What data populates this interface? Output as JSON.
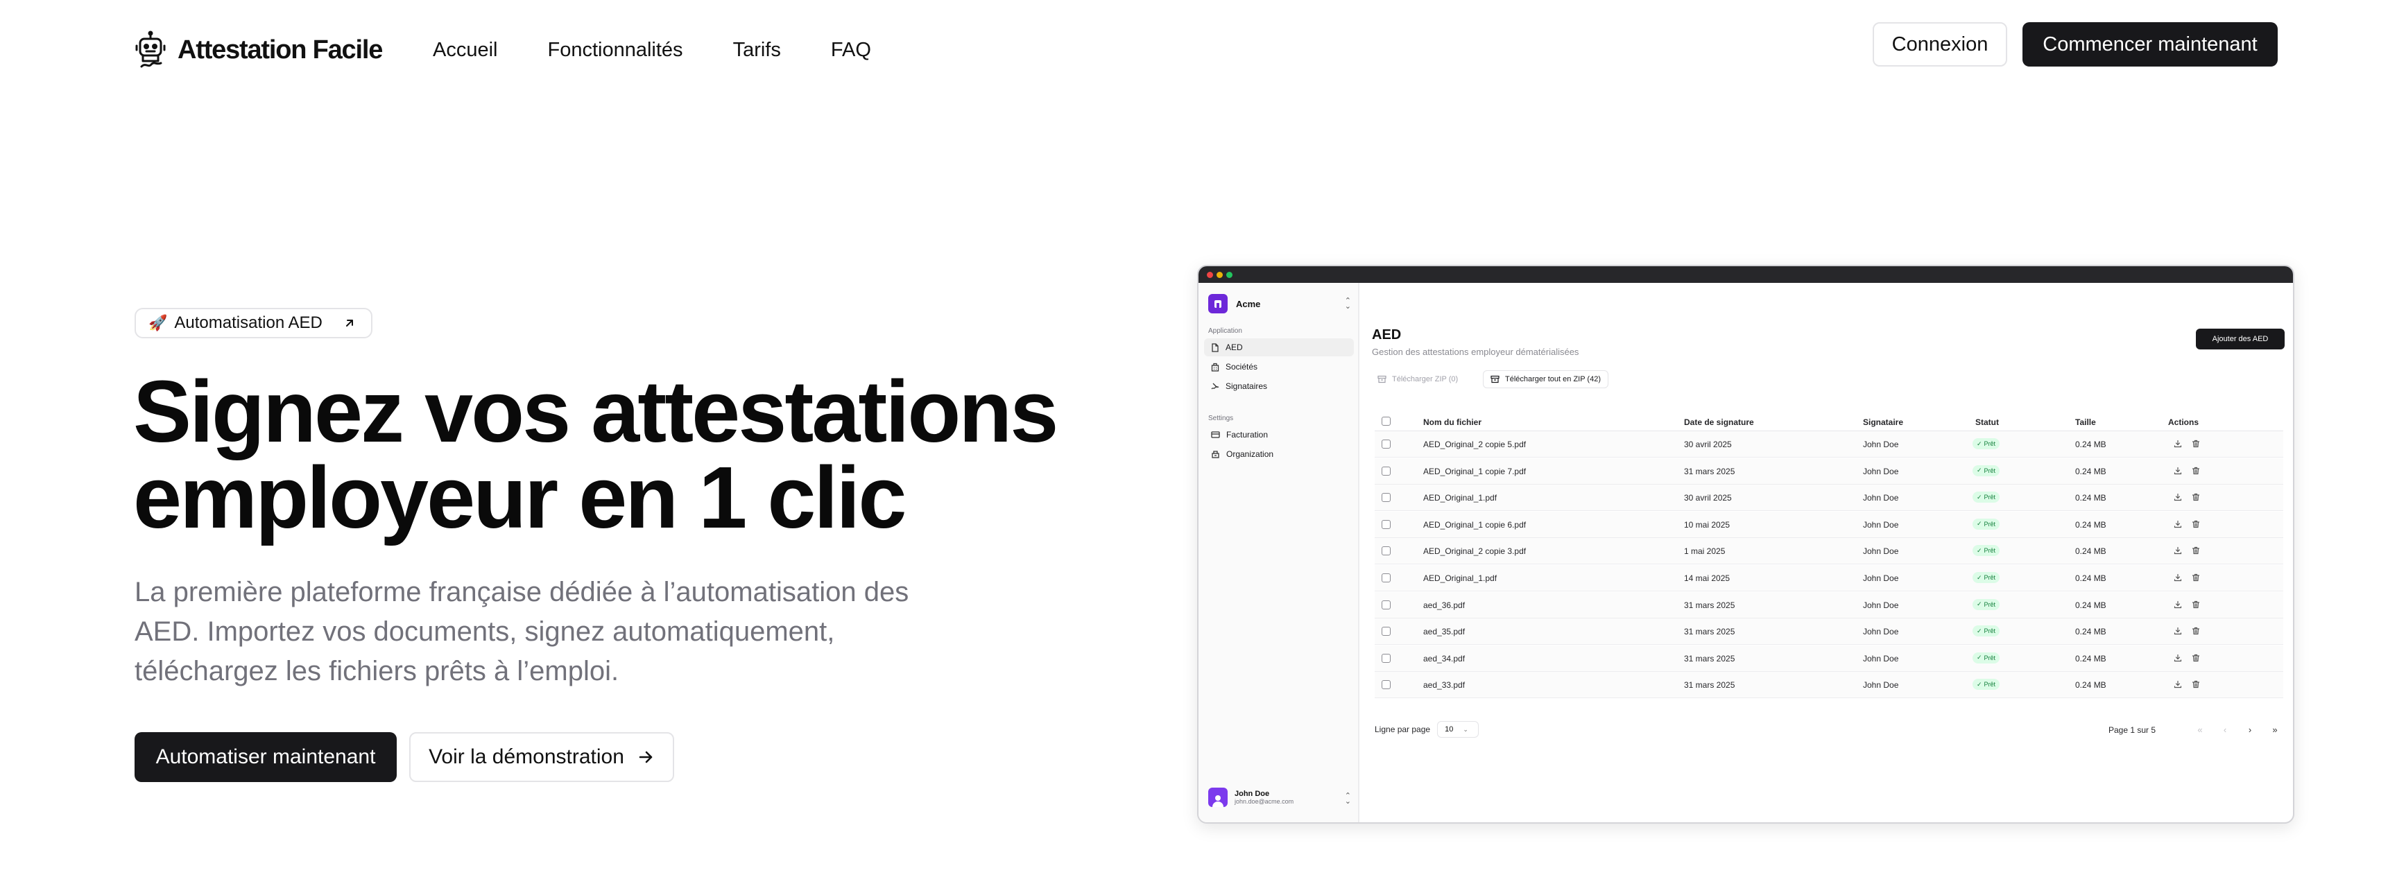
{
  "brand": {
    "name": "Attestation Facile"
  },
  "nav": {
    "links": [
      "Accueil",
      "Fonctionnalités",
      "Tarifs",
      "FAQ"
    ],
    "login": "Connexion",
    "start": "Commencer maintenant"
  },
  "hero": {
    "badge": "Automatisation AED",
    "badge_emoji": "🚀",
    "title_line1": "Signez vos attestations",
    "title_line2": "employeur en 1 clic",
    "sub_line1": "La première plateforme française dédiée à l’automatisation des",
    "sub_line2": "AED. Importez vos documents, signez automatiquement,",
    "sub_line3": "téléchargez les fichiers prêts à l’emploi.",
    "cta_primary": "Automatiser maintenant",
    "cta_secondary": "Voir la démonstration"
  },
  "app": {
    "org": "Acme",
    "sidebar": {
      "group1": "Application",
      "items1": [
        "AED",
        "Sociétés",
        "Signataires"
      ],
      "group2": "Settings",
      "items2": [
        "Facturation",
        "Organization"
      ]
    },
    "user": {
      "name": "John Doe",
      "email": "john.doe@acme.com"
    },
    "page": {
      "title": "AED",
      "subtitle": "Gestion des attestations employeur dématérialisées",
      "add_button": "Ajouter des AED",
      "zip_selected": "Télécharger ZIP (0)",
      "zip_all": "Télécharger tout en ZIP (42)"
    },
    "table": {
      "headers": [
        "Nom du fichier",
        "Date de signature",
        "Signataire",
        "Statut",
        "Taille",
        "Actions"
      ],
      "rows": [
        {
          "file": "AED_Original_2 copie 5.pdf",
          "date": "30 avril 2025",
          "signer": "John Doe",
          "status": "Prêt",
          "size": "0.24 MB"
        },
        {
          "file": "AED_Original_1 copie 7.pdf",
          "date": "31 mars 2025",
          "signer": "John Doe",
          "status": "Prêt",
          "size": "0.24 MB"
        },
        {
          "file": "AED_Original_1.pdf",
          "date": "30 avril 2025",
          "signer": "John Doe",
          "status": "Prêt",
          "size": "0.24 MB"
        },
        {
          "file": "AED_Original_1 copie 6.pdf",
          "date": "10 mai 2025",
          "signer": "John Doe",
          "status": "Prêt",
          "size": "0.24 MB"
        },
        {
          "file": "AED_Original_2 copie 3.pdf",
          "date": "1 mai 2025",
          "signer": "John Doe",
          "status": "Prêt",
          "size": "0.24 MB"
        },
        {
          "file": "AED_Original_1.pdf",
          "date": "14 mai 2025",
          "signer": "John Doe",
          "status": "Prêt",
          "size": "0.24 MB"
        },
        {
          "file": "aed_36.pdf",
          "date": "31 mars 2025",
          "signer": "John Doe",
          "status": "Prêt",
          "size": "0.24 MB"
        },
        {
          "file": "aed_35.pdf",
          "date": "31 mars 2025",
          "signer": "John Doe",
          "status": "Prêt",
          "size": "0.24 MB"
        },
        {
          "file": "aed_34.pdf",
          "date": "31 mars 2025",
          "signer": "John Doe",
          "status": "Prêt",
          "size": "0.24 MB"
        },
        {
          "file": "aed_33.pdf",
          "date": "31 mars 2025",
          "signer": "John Doe",
          "status": "Prêt",
          "size": "0.24 MB"
        }
      ]
    },
    "pagination": {
      "rows_label": "Ligne par page",
      "rows_value": "10",
      "page_info": "Page 1 sur 5",
      "first": "«",
      "prev": "‹",
      "next": "›",
      "last": "»"
    }
  },
  "colors": {
    "primary": "#18181b",
    "muted_text": "#71717a",
    "status_bg": "#dcfce7",
    "status_text": "#15803d",
    "accent_purple": "#6d28d9"
  }
}
